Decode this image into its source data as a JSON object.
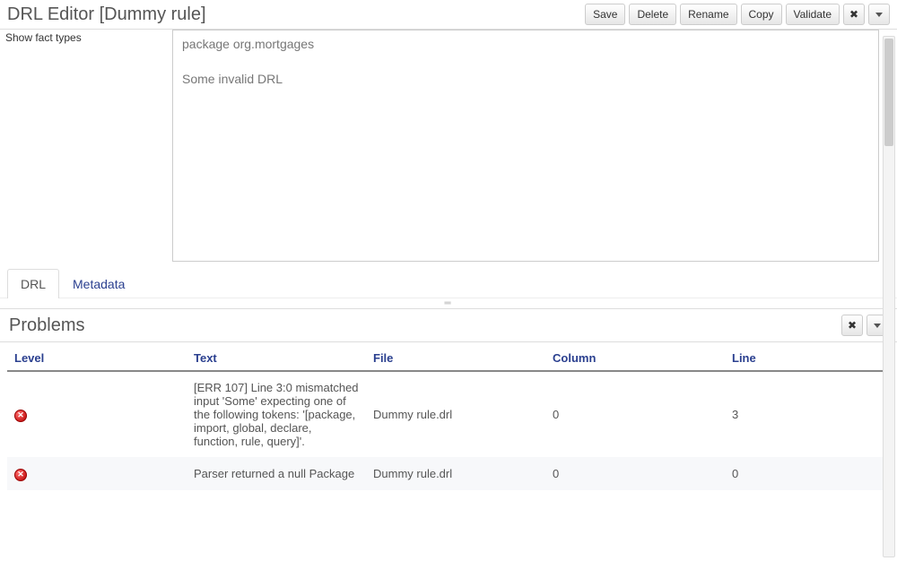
{
  "header": {
    "title": "DRL Editor [Dummy rule]",
    "buttons": {
      "save": "Save",
      "delete": "Delete",
      "rename": "Rename",
      "copy": "Copy",
      "validate": "Validate"
    }
  },
  "editor": {
    "factTypesLabel": "Show fact types",
    "code": "package org.mortgages\n\nSome invalid DRL"
  },
  "tabs": {
    "drl": "DRL",
    "metadata": "Metadata"
  },
  "problems": {
    "title": "Problems",
    "columns": {
      "level": "Level",
      "text": "Text",
      "file": "File",
      "column": "Column",
      "line": "Line"
    },
    "rows": [
      {
        "level": "error",
        "text": "[ERR 107] Line 3:0 mismatched input 'Some' expecting one of the following tokens: '[package, import, global, declare, function, rule, query]'.",
        "file": "Dummy rule.drl",
        "column": "0",
        "line": "3"
      },
      {
        "level": "error",
        "text": "Parser returned a null Package",
        "file": "Dummy rule.drl",
        "column": "0",
        "line": "0"
      }
    ]
  }
}
